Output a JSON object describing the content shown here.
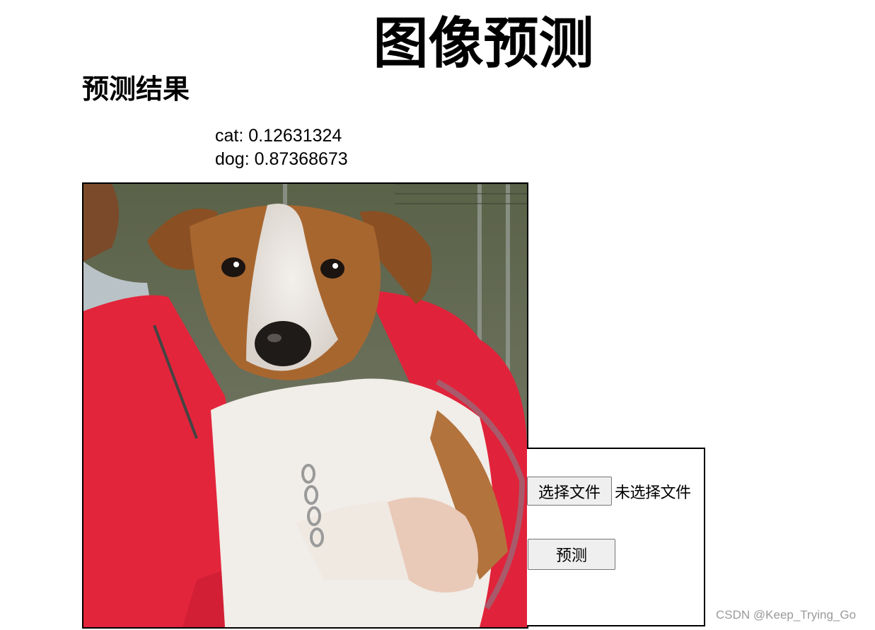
{
  "page": {
    "title": "图像预测",
    "section_title": "预测结果"
  },
  "results": [
    {
      "label": "cat",
      "score": "0.12631324",
      "text": "cat: 0.12631324"
    },
    {
      "label": "dog",
      "score": "0.87368673",
      "text": "dog: 0.87368673"
    }
  ],
  "form": {
    "choose_file_label": "选择文件",
    "no_file_text": "未选择文件",
    "predict_label": "预测"
  },
  "image": {
    "subject": "dog held by person in red jacket"
  },
  "watermark": "CSDN @Keep_Trying_Go"
}
